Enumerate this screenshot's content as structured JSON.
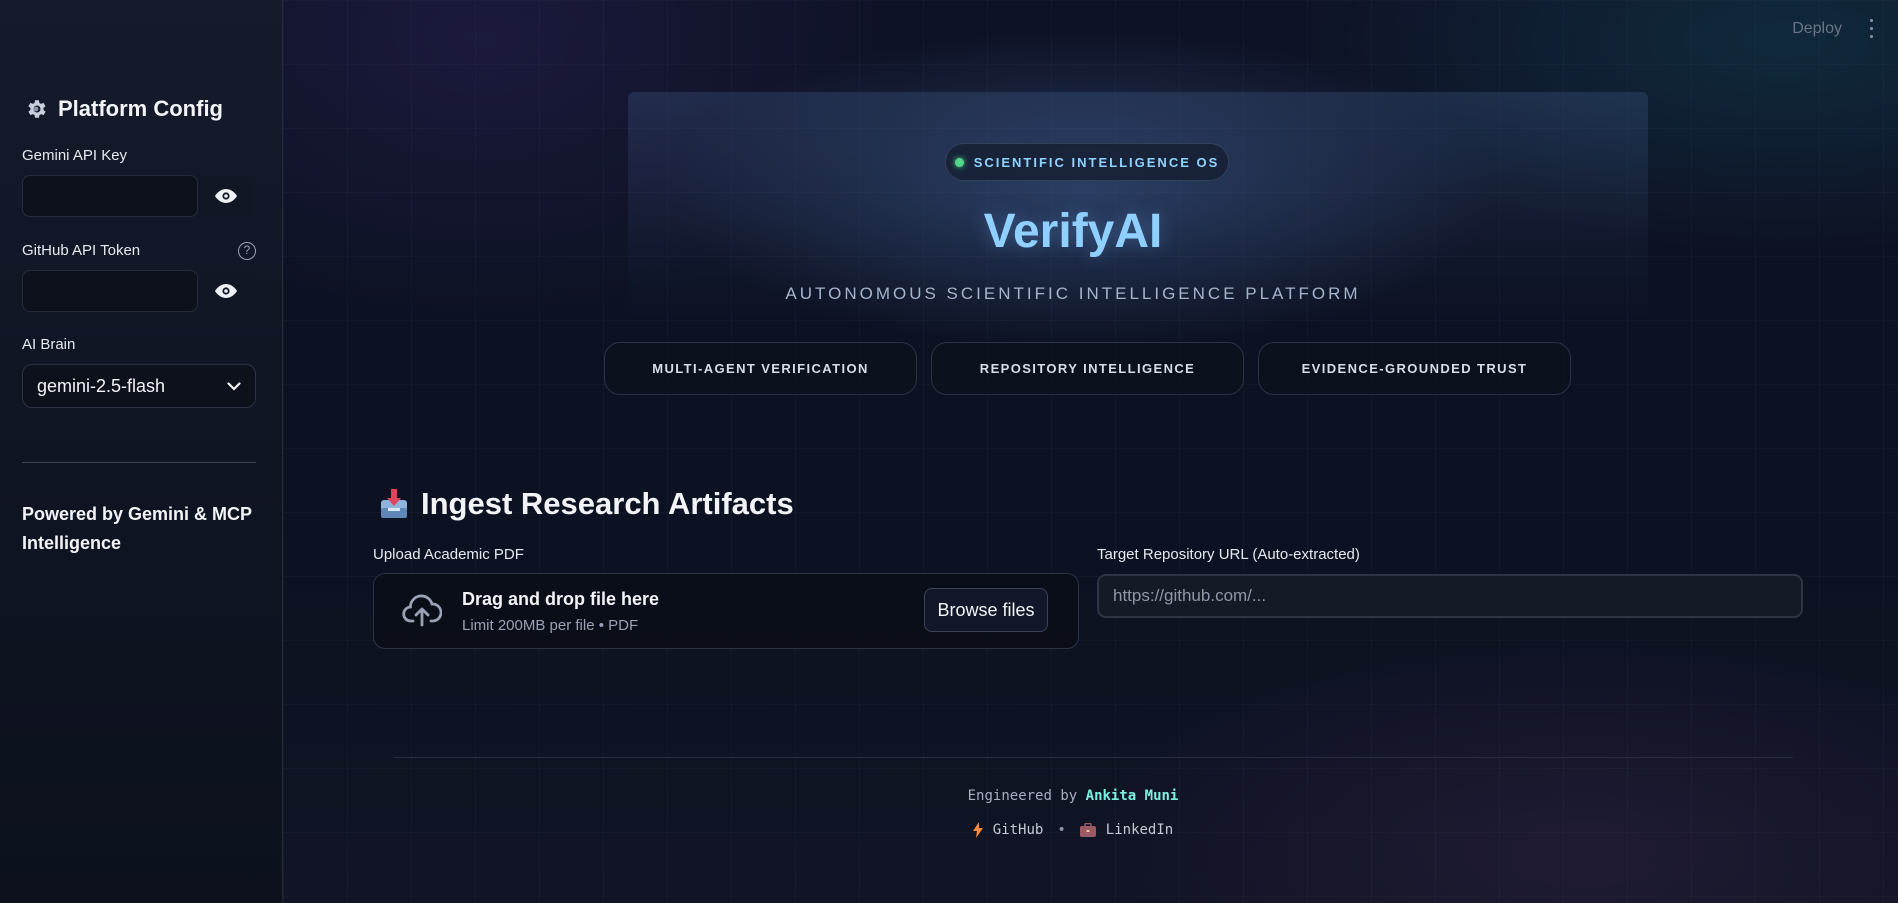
{
  "sidebar": {
    "title": "Platform Config",
    "gemini_label": "Gemini API Key",
    "github_label": "GitHub API Token",
    "help_glyph": "?",
    "ai_label": "AI Brain",
    "ai_value": "gemini-2.5-flash",
    "powered": "Powered by Gemini & MCP Intelligence"
  },
  "header": {
    "deploy": "Deploy"
  },
  "hero": {
    "badge": "SCIENTIFIC INTELLIGENCE OS",
    "title": "VerifyAI",
    "subtitle": "AUTONOMOUS SCIENTIFIC INTELLIGENCE PLATFORM",
    "pills": [
      "MULTI-AGENT VERIFICATION",
      "REPOSITORY INTELLIGENCE",
      "EVIDENCE-GROUNDED TRUST"
    ]
  },
  "ingest": {
    "heading": "Ingest Research Artifacts",
    "upload_label": "Upload Academic PDF",
    "drop_title": "Drag and drop file here",
    "drop_limit": "Limit 200MB per file • PDF",
    "browse": "Browse files",
    "repo_label": "Target Repository URL (Auto-extracted)",
    "repo_placeholder": "https://github.com/..."
  },
  "footer": {
    "engineered_by": "Engineered by",
    "author": "Ankita Muni",
    "github": "GitHub",
    "separator": "•",
    "linkedin": "LinkedIn"
  },
  "colors": {
    "accent": "#8fd0ff",
    "badge_dot": "#54d68a",
    "author": "#7ef0e0"
  },
  "icons": [
    "gear-icon",
    "eye-icon",
    "help-icon",
    "chevron-down-icon",
    "inbox-tray-icon",
    "cloud-upload-icon",
    "bolt-icon",
    "briefcase-icon"
  ]
}
